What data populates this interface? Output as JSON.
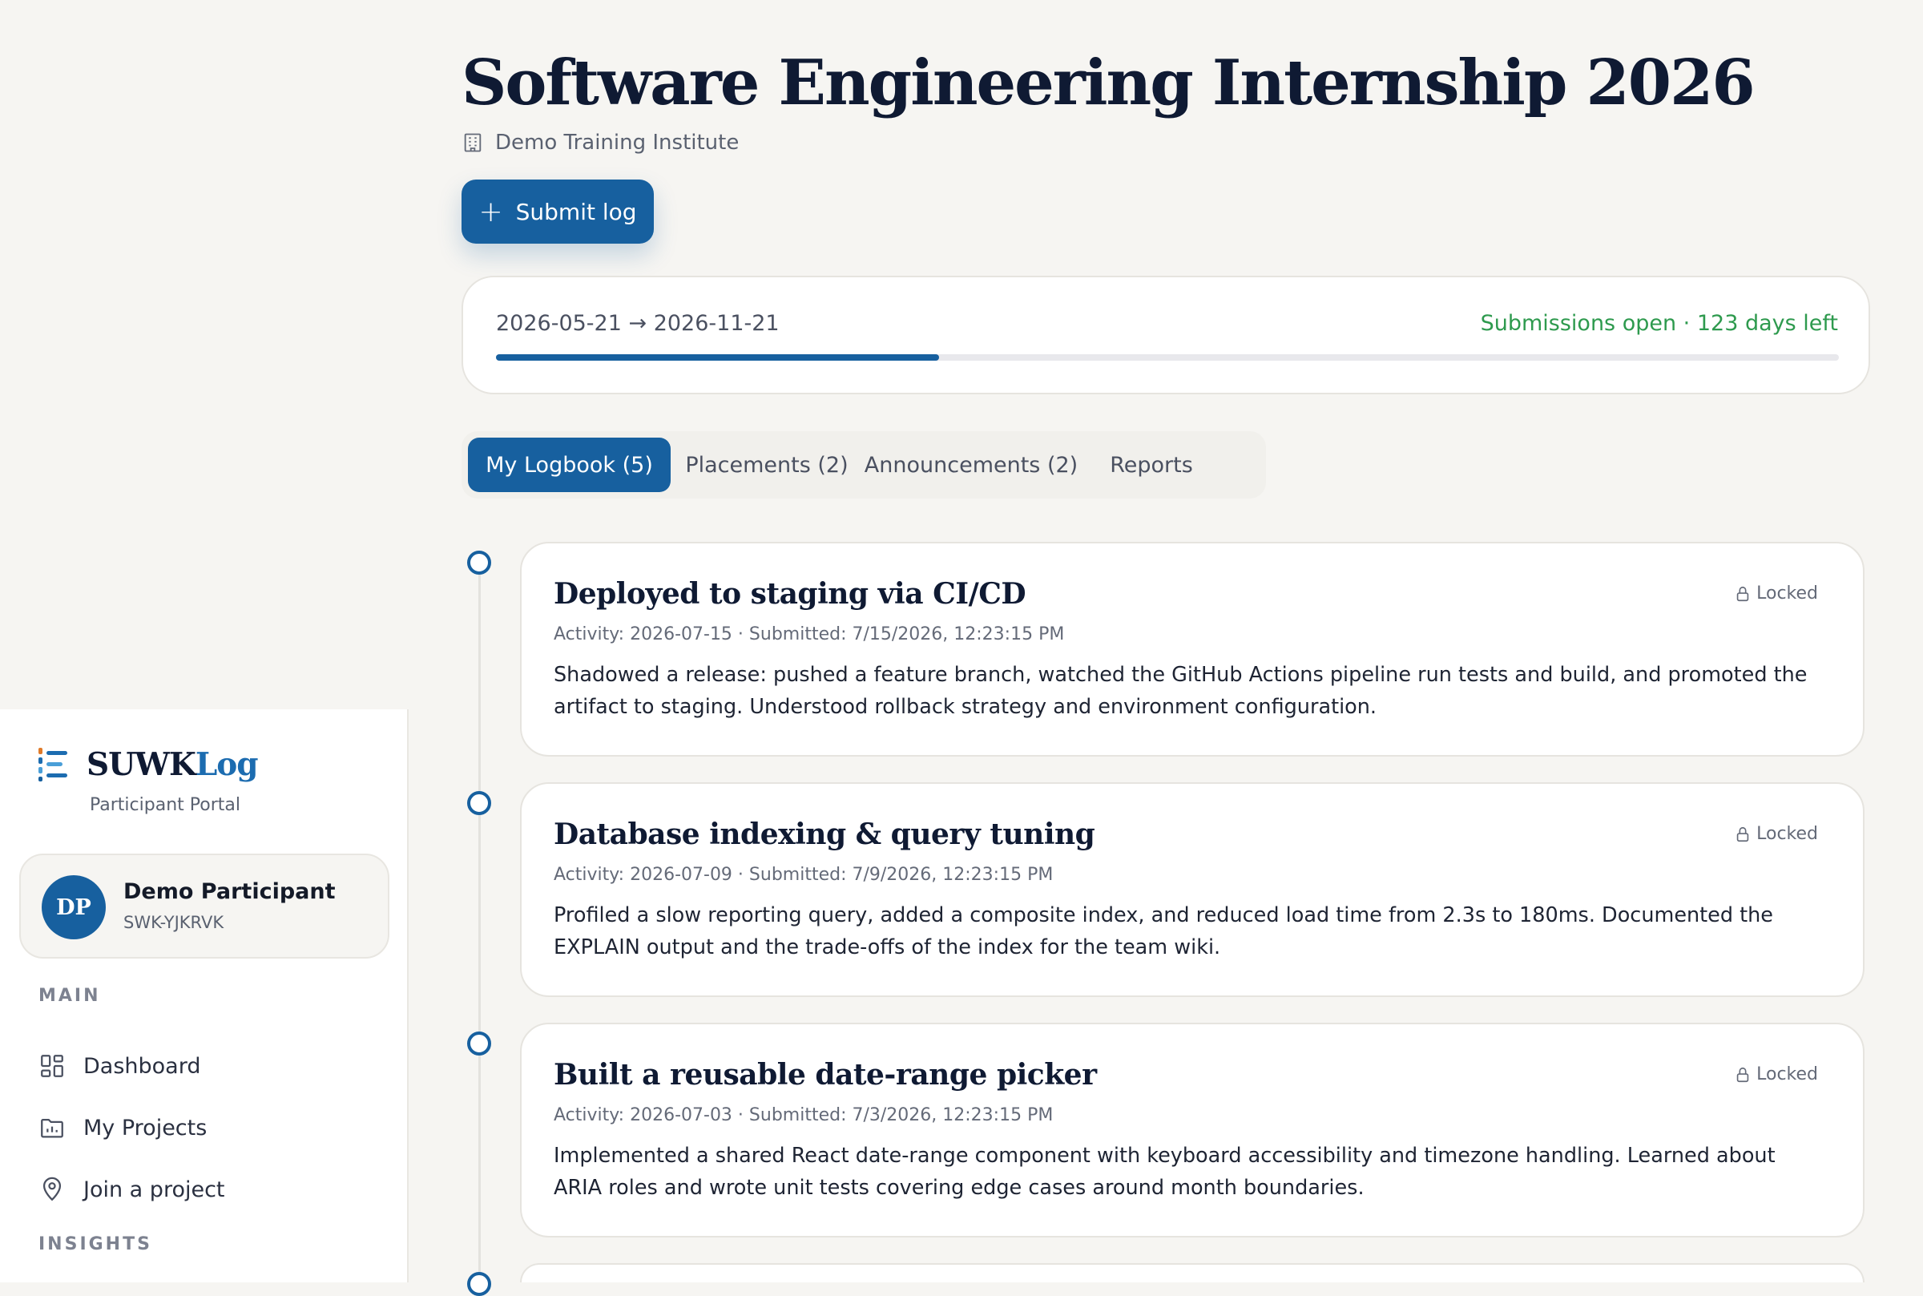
{
  "brand": {
    "name_a": "SUWK",
    "name_b": "Log",
    "subtitle": "Participant Portal"
  },
  "user": {
    "initials": "DP",
    "name": "Demo Participant",
    "id": "SWK-YJKRVK"
  },
  "nav": {
    "main_label": "MAIN",
    "items": [
      {
        "label": "Dashboard",
        "icon": "dashboard-icon"
      },
      {
        "label": "My Projects",
        "icon": "folder-icon"
      },
      {
        "label": "Join a project",
        "icon": "location-pin-icon"
      }
    ],
    "insights_label": "INSIGHTS"
  },
  "project": {
    "title": "Software Engineering Internship 2026",
    "organization": "Demo Training Institute",
    "submit_label": "Submit log",
    "dates": "2026-05-21 → 2026-11-21",
    "status": "Submissions open · 123 days left",
    "progress": 0.33
  },
  "tabs": [
    {
      "label": "My Logbook (5)",
      "active": true
    },
    {
      "label": "Placements (2)",
      "active": false
    },
    {
      "label": "Announcements (2)",
      "active": false
    },
    {
      "label": "Reports",
      "active": false
    }
  ],
  "logs": [
    {
      "title": "Deployed to staging via CI/CD",
      "meta": "Activity: 2026-07-15 · Submitted: 7/15/2026, 12:23:15 PM",
      "body": "Shadowed a release: pushed a feature branch, watched the GitHub Actions pipeline run tests and build, and promoted the artifact to staging. Understood rollback strategy and environment configuration.",
      "lock": "Locked"
    },
    {
      "title": "Database indexing & query tuning",
      "meta": "Activity: 2026-07-09 · Submitted: 7/9/2026, 12:23:15 PM",
      "body": "Profiled a slow reporting query, added a composite index, and reduced load time from 2.3s to 180ms. Documented the EXPLAIN output and the trade-offs of the index for the team wiki.",
      "lock": "Locked"
    },
    {
      "title": "Built a reusable date-range picker",
      "meta": "Activity: 2026-07-03 · Submitted: 7/3/2026, 12:23:15 PM",
      "body": "Implemented a shared React date-range component with keyboard accessibility and timezone handling. Learned about ARIA roles and wrote unit tests covering edge cases around month boundaries.",
      "lock": "Locked"
    }
  ],
  "colors": {
    "accent": "#17609f",
    "status_green": "#2e9a4e",
    "heading": "#0f1a33"
  }
}
